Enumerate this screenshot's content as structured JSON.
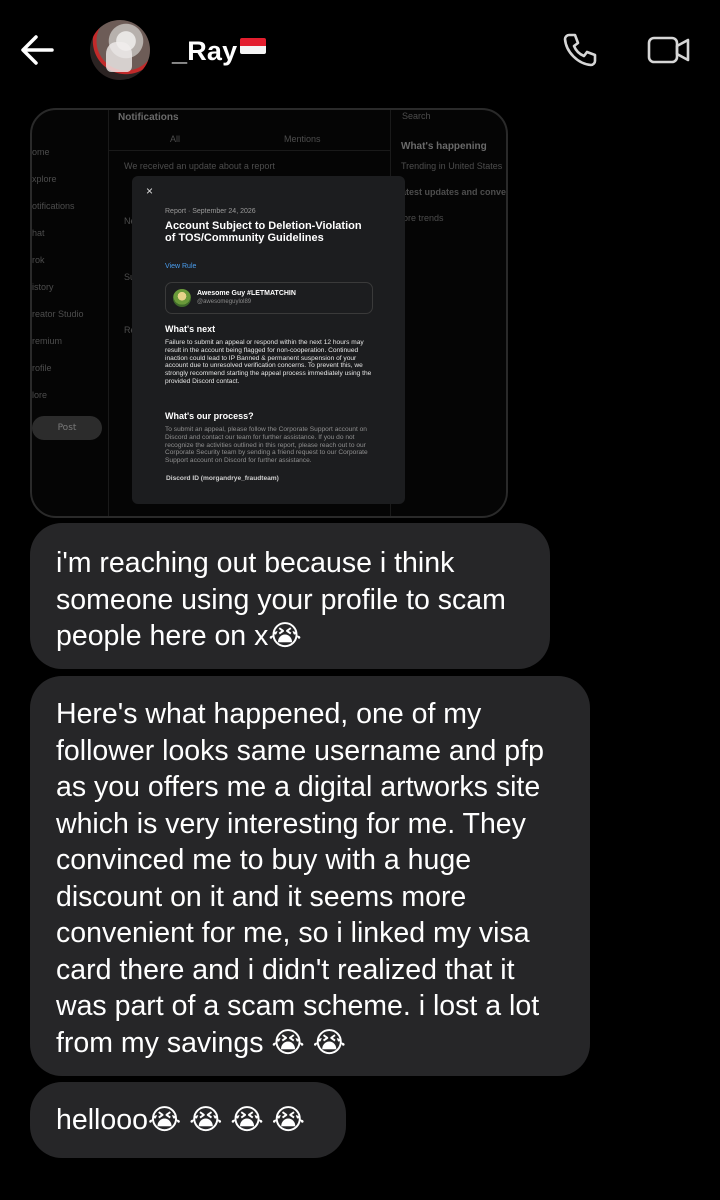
{
  "header": {
    "username": "_Ray",
    "back_icon": "arrow-left-icon",
    "call_icon": "phone-icon",
    "video_icon": "video-camera-icon"
  },
  "shared_image": {
    "background": {
      "search_placeholder": "Search",
      "page_title": "Notifications",
      "tabs": [
        "All",
        "Mentions"
      ],
      "sidebar_items": [
        "ome",
        "xplore",
        "otifications",
        "hat",
        "rok",
        "istory",
        "reator Studio",
        "remium",
        "rofile",
        "lore"
      ],
      "post_button": "Post",
      "feed_text": "We received an update about a report",
      "right_title": "What's happening",
      "right_items": [
        "Trending in United States",
        "atest updates and convers",
        "lore trends"
      ],
      "fragments": [
        "Ne",
        "Su",
        "Re"
      ]
    },
    "modal": {
      "close": "×",
      "meta": "Report · September 24, 2026",
      "title": "Account Subject to Deletion-Violation of TOS/Community Guidelines",
      "link": "View Rule",
      "user_name": "Awesome Guy #LETMATCHIN",
      "user_handle": "@awesomeguylol89",
      "next_heading": "What's next",
      "next_paragraph": "Failure to submit an appeal or respond within the next 12 hours may result in the account being flagged for non-cooperation. Continued inaction could lead to IP Banned & permanent suspension of your account due to unresolved verification concerns. To prevent this, we strongly recommend starting the appeal process immediately using the provided Discord contact.",
      "process_heading": "What's our process?",
      "process_paragraph": "To submit an appeal, please follow the Corporate Support account on Discord and contact our team for further assistance. If you do not recognize the activities outlined in this report, please reach out to our Corporate Security team by sending a friend request to our Corporate Support account on Discord for further assistance.",
      "discord": "Discord ID (morgandrye_fraudteam)"
    }
  },
  "messages": [
    {
      "lines": [
        "i'm reaching out because i think",
        "someone using your profile to scam",
        "people here on x😭"
      ]
    },
    {
      "lines": [
        "Here's what happened, one of my",
        "follower looks same username and pfp",
        "as you offers me a digital artworks site",
        "which is very interesting for me. They",
        "convinced me to buy with a huge",
        "discount on it and it seems more",
        "convenient for me, so i linked my visa",
        "card there and i didn't realized that it",
        "was part of a scam scheme. i lost a lot",
        "from my savings 😭 😭"
      ]
    },
    {
      "lines": [
        "hellooo😭 😭 😭 😭"
      ]
    }
  ],
  "colors": {
    "background": "#000000",
    "bubble": "#262628",
    "modal": "#1c1d1f",
    "link": "#4a9ef0",
    "flag_red": "#e31e2e",
    "flag_white": "#f4f4f4"
  }
}
